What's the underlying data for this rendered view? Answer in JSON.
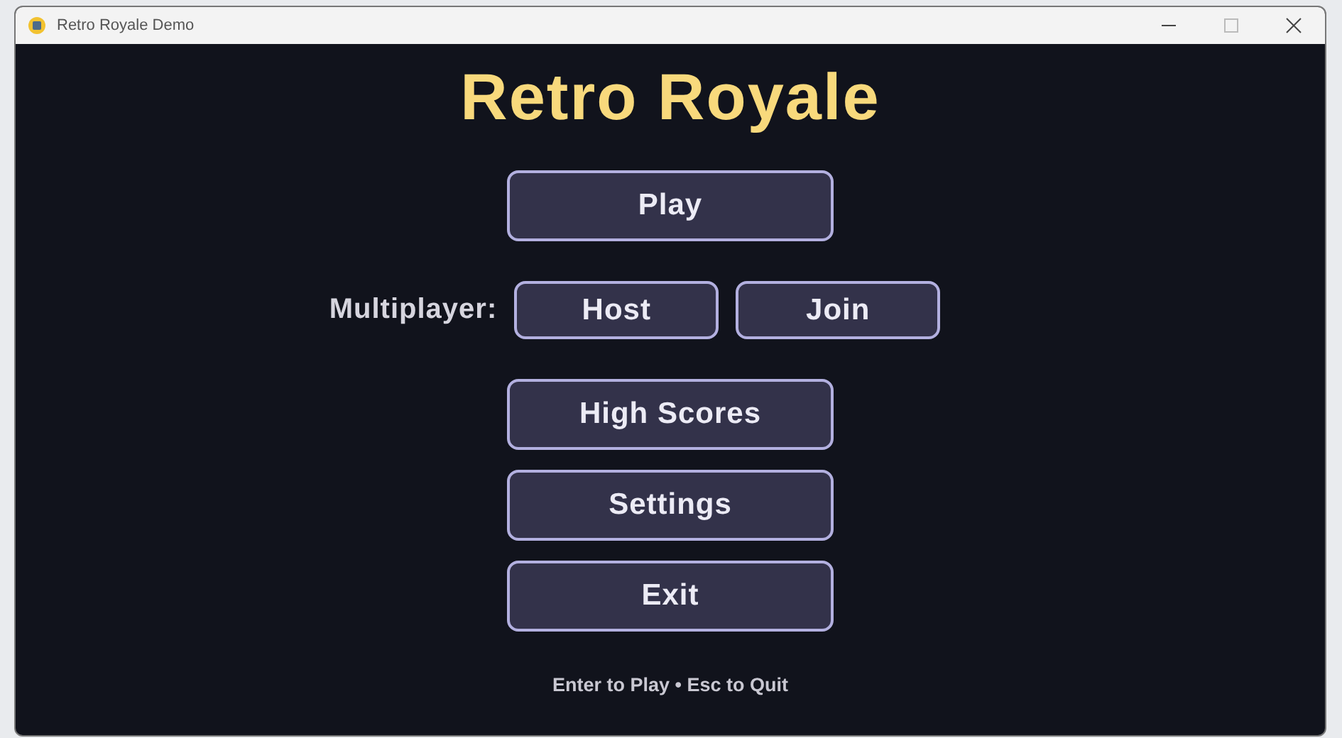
{
  "window": {
    "title": "Retro Royale Demo"
  },
  "title": "Retro Royale",
  "menu": [
    {
      "kind": "button",
      "label": "Play"
    },
    {
      "kind": "row",
      "label": "Multiplayer:",
      "buttons": [
        "Host",
        "Join"
      ]
    },
    {
      "kind": "button",
      "label": "High Scores"
    },
    {
      "kind": "button",
      "label": "Settings"
    },
    {
      "kind": "button",
      "label": "Exit"
    }
  ],
  "hint": "Enter to Play • Esc to Quit"
}
